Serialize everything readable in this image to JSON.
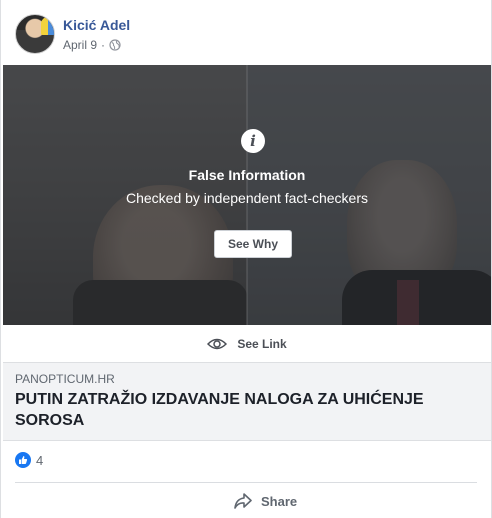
{
  "post": {
    "author": "Kicić Adel",
    "date": "April 9",
    "separator": "·",
    "privacy_icon": "globe-icon"
  },
  "media": {
    "warning_icon": "info-icon",
    "warning_glyph": "i",
    "warning_title": "False Information",
    "warning_subtitle": "Checked by independent fact-checkers",
    "see_why_label": "See Why"
  },
  "see_link": {
    "icon": "eye-icon",
    "label": "See Link"
  },
  "link_preview": {
    "domain": "PANOPTICUM.HR",
    "headline": "PUTIN ZATRAŽIO IZDAVANJE NALOGA ZA UHIĆENJE SOROSA"
  },
  "reactions": {
    "icon": "like-icon",
    "count": "4"
  },
  "actions": {
    "share_label": "Share",
    "share_icon": "share-icon"
  },
  "colors": {
    "author_link": "#385898",
    "like_blue": "#1877f2",
    "preview_bg": "#f2f3f5"
  }
}
